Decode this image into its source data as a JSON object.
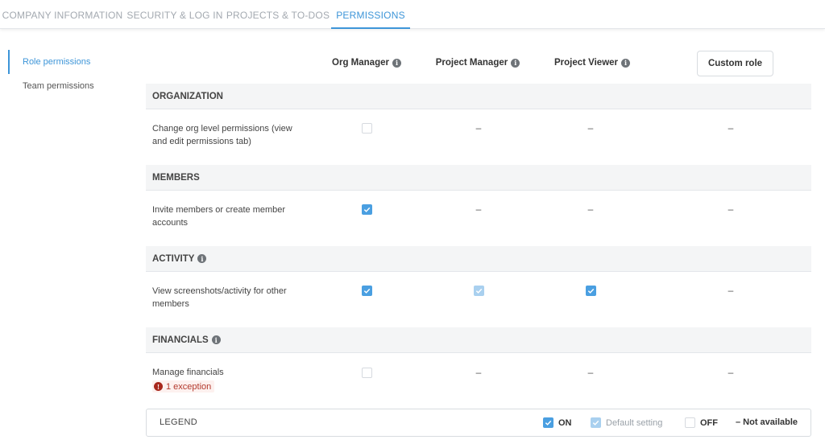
{
  "tabs": [
    {
      "label": "COMPANY INFORMATION",
      "active": false
    },
    {
      "label": "SECURITY & LOG IN",
      "active": false
    },
    {
      "label": "PROJECTS & TO-DOS",
      "active": false
    },
    {
      "label": "PERMISSIONS",
      "active": true
    }
  ],
  "sidebar": {
    "items": [
      {
        "label": "Role permissions",
        "active": true
      },
      {
        "label": "Team permissions",
        "active": false
      }
    ]
  },
  "roles": [
    {
      "label": "Org Manager",
      "info_icon": "info-icon"
    },
    {
      "label": "Project Manager",
      "info_icon": "info-icon"
    },
    {
      "label": "Project Viewer",
      "info_icon": "info-icon"
    }
  ],
  "custom_role_label": "Custom role",
  "sections": [
    {
      "title": "ORGANIZATION",
      "has_info": false,
      "row": {
        "label": "Change org level permissions (view and edit permissions tab)",
        "cells": [
          "off",
          "na",
          "na",
          "na"
        ]
      }
    },
    {
      "title": "MEMBERS",
      "has_info": false,
      "row": {
        "label": "Invite members or create member accounts",
        "cells": [
          "on",
          "na",
          "na",
          "na"
        ]
      }
    },
    {
      "title": "ACTIVITY",
      "has_info": true,
      "row": {
        "label": "View screenshots/activity for other members",
        "cells": [
          "on",
          "default",
          "on",
          "na"
        ]
      }
    },
    {
      "title": "FINANCIALS",
      "has_info": true,
      "row": {
        "label": "Manage financials",
        "cells": [
          "off",
          "na",
          "na",
          "na"
        ],
        "exception": "1 exception"
      }
    }
  ],
  "na_symbol": "–",
  "legend": {
    "title": "LEGEND",
    "on": "ON",
    "default": "Default setting",
    "off": "OFF",
    "na": "– Not available"
  },
  "colors": {
    "accent": "#3d95d8",
    "checkbox_on": "#4a9fe1",
    "checkbox_default": "#a9d0ef",
    "exception_text": "#b3392d"
  }
}
